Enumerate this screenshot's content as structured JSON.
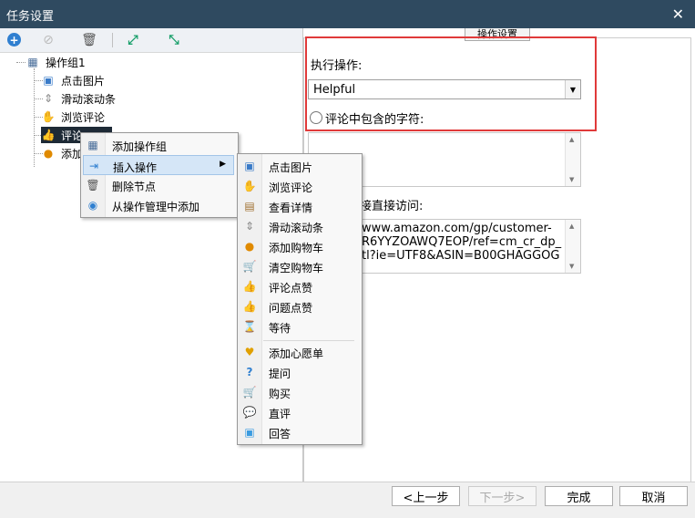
{
  "window": {
    "title": "任务设置"
  },
  "tree": {
    "root": "操作组1",
    "children": [
      "点击图片",
      "滑动滚动条",
      "浏览评论",
      "评论点赞",
      "添加购物车"
    ]
  },
  "tree_visible": {
    "selected_prefix": "评论",
    "last_prefix": "添加"
  },
  "context_menu": {
    "items": [
      "添加操作组",
      "插入操作",
      "删除节点",
      "从操作管理中添加"
    ]
  },
  "submenu": {
    "items": [
      "点击图片",
      "浏览评论",
      "查看详情",
      "滑动滚动条",
      "添加购物车",
      "清空购物车",
      "评论点赞",
      "问题点赞",
      "等待",
      "添加心愿单",
      "提问",
      "购买",
      "直评",
      "回答"
    ]
  },
  "right": {
    "tab_label": "操作设置",
    "exec_label": "执行操作:",
    "exec_value": "Helpful",
    "radio_label": "评论中包含的字符:",
    "link_label_visible": "接直接访问:",
    "url_lines": [
      "www.amazon.com/gp/customer-",
      "R6YYZOAWQ7EOP/ref=cm_cr_dp_",
      "tl?ie=UTF8&ASIN=B00GHAGGOG"
    ]
  },
  "buttons": {
    "prev": "<上一步",
    "next": "下一步>",
    "finish": "完成",
    "cancel": "取消"
  },
  "colors": {
    "titlebar": "#2f4a60",
    "highlight_border": "#e03a3a",
    "selection": "#1e2a36"
  }
}
